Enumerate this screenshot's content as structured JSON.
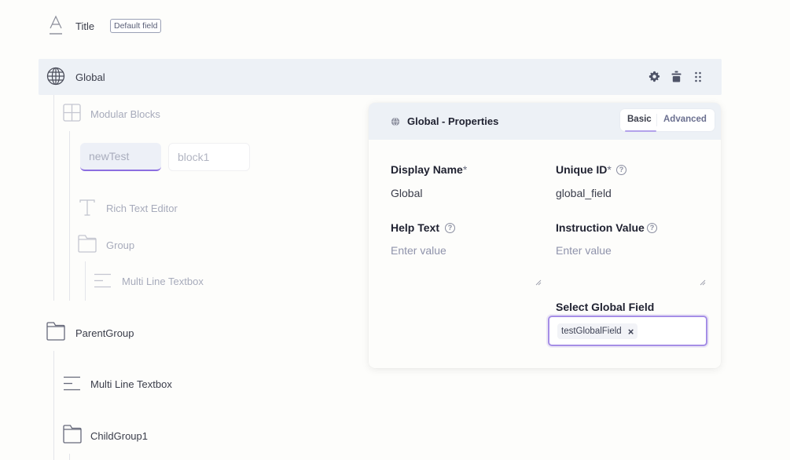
{
  "title_row": {
    "label": "Title",
    "badge": "Default field",
    "icon": "text-underline-icon"
  },
  "global_row": {
    "label": "Global",
    "icon": "globe-icon",
    "actions": [
      "gear-icon",
      "delete-icon",
      "drag-handle-icon"
    ]
  },
  "tree": {
    "modular_blocks": {
      "label": "Modular Blocks",
      "icon": "grid-icon"
    },
    "blocks": [
      {
        "label": "newTest",
        "active": true
      },
      {
        "label": "block1",
        "active": false
      }
    ],
    "rich_text": {
      "label": "Rich Text Editor",
      "icon": "text-t-icon"
    },
    "group": {
      "label": "Group",
      "icon": "folder-icon"
    },
    "group_child": {
      "label": "Multi Line Textbox",
      "icon": "lines-icon"
    },
    "parent_group": {
      "label": "ParentGroup",
      "icon": "folder-icon"
    },
    "parent_child_1": {
      "label": "Multi Line Textbox",
      "icon": "lines-icon"
    },
    "parent_child_2": {
      "label": "ChildGroup1",
      "icon": "folder-icon"
    }
  },
  "properties_panel": {
    "title": "Global - Properties",
    "tabs": [
      {
        "label": "Basic",
        "active": true
      },
      {
        "label": "Advanced",
        "active": false
      }
    ],
    "display_name": {
      "label": "Display Name",
      "required_mark": "*",
      "value": "Global"
    },
    "unique_id": {
      "label": "Unique ID",
      "required_mark": "*",
      "value": "global_field"
    },
    "help_text": {
      "label": "Help Text",
      "placeholder": "Enter value"
    },
    "instruction_value": {
      "label": "Instruction Value",
      "placeholder": "Enter value"
    },
    "select_global_field": {
      "label": "Select Global Field",
      "selected": "testGlobalField",
      "remove_glyph": "×"
    },
    "help_glyph": "?"
  },
  "colors": {
    "accent": "#8c6ee0",
    "row_highlight": "#edf1f6"
  }
}
